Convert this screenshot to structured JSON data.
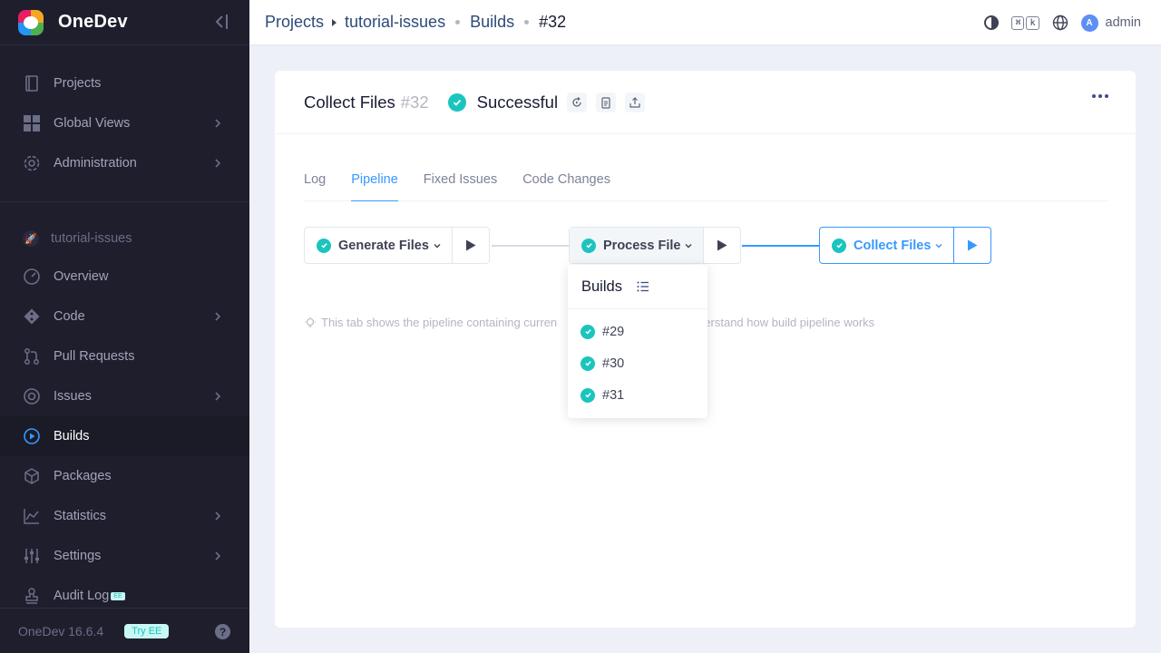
{
  "app": {
    "name": "OneDev",
    "version": "OneDev 16.6.4",
    "try_ee": "Try EE"
  },
  "sidebar": {
    "global_items": [
      {
        "label": "Projects",
        "icon": "book-icon"
      },
      {
        "label": "Global Views",
        "icon": "grid-icon"
      },
      {
        "label": "Administration",
        "icon": "gear-icon"
      }
    ],
    "project_name": "tutorial-issues",
    "project_items": [
      {
        "label": "Overview",
        "icon": "gauge-icon"
      },
      {
        "label": "Code",
        "icon": "git-icon"
      },
      {
        "label": "Pull Requests",
        "icon": "pull-request-icon"
      },
      {
        "label": "Issues",
        "icon": "target-icon"
      },
      {
        "label": "Builds",
        "icon": "play-circle-icon"
      },
      {
        "label": "Packages",
        "icon": "box-icon"
      },
      {
        "label": "Statistics",
        "icon": "chart-icon"
      },
      {
        "label": "Settings",
        "icon": "sliders-icon"
      },
      {
        "label": "Audit Log",
        "icon": "stamp-icon",
        "badge": "EE"
      }
    ],
    "active": "Builds"
  },
  "breadcrumb": {
    "projects": "Projects",
    "project": "tutorial-issues",
    "builds": "Builds",
    "current": "#32"
  },
  "topbar": {
    "kbd_cmd": "⌘",
    "kbd_k": "k",
    "avatar_letter": "A",
    "user": "admin"
  },
  "build": {
    "title": "Collect Files",
    "number": "#32",
    "status": "Successful",
    "status_color": "#1bc5bd"
  },
  "tabs": [
    "Log",
    "Pipeline",
    "Fixed Issues",
    "Code Changes"
  ],
  "active_tab": "Pipeline",
  "pipeline": {
    "jobs": [
      {
        "name": "Generate Files"
      },
      {
        "name": "Process File"
      },
      {
        "name": "Collect Files"
      }
    ],
    "dropdown": {
      "title": "Builds",
      "items": [
        "#29",
        "#30",
        "#31"
      ]
    }
  },
  "tip": {
    "left": "This tab shows the pipeline containing curren",
    "right": "to understand how build pipeline works"
  },
  "colors": {
    "accent": "#3699ff",
    "success": "#1bc5bd",
    "sidebar_bg": "#1e1e2d"
  }
}
